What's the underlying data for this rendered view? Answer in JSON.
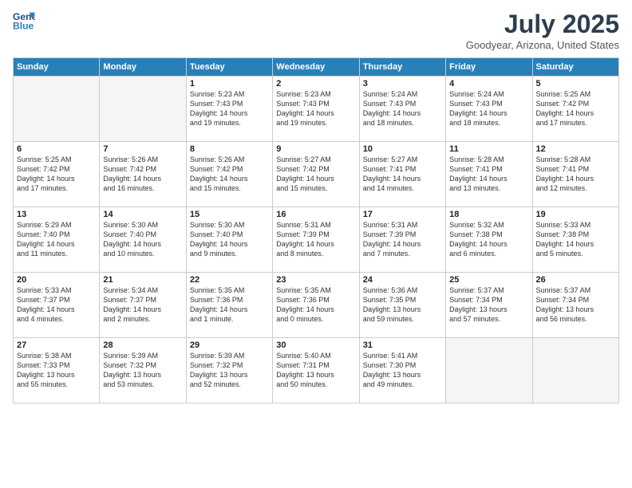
{
  "header": {
    "logo_line1": "General",
    "logo_line2": "Blue",
    "month": "July 2025",
    "location": "Goodyear, Arizona, United States"
  },
  "days_of_week": [
    "Sunday",
    "Monday",
    "Tuesday",
    "Wednesday",
    "Thursday",
    "Friday",
    "Saturday"
  ],
  "weeks": [
    [
      {
        "day": "",
        "text": ""
      },
      {
        "day": "",
        "text": ""
      },
      {
        "day": "1",
        "text": "Sunrise: 5:23 AM\nSunset: 7:43 PM\nDaylight: 14 hours\nand 19 minutes."
      },
      {
        "day": "2",
        "text": "Sunrise: 5:23 AM\nSunset: 7:43 PM\nDaylight: 14 hours\nand 19 minutes."
      },
      {
        "day": "3",
        "text": "Sunrise: 5:24 AM\nSunset: 7:43 PM\nDaylight: 14 hours\nand 18 minutes."
      },
      {
        "day": "4",
        "text": "Sunrise: 5:24 AM\nSunset: 7:43 PM\nDaylight: 14 hours\nand 18 minutes."
      },
      {
        "day": "5",
        "text": "Sunrise: 5:25 AM\nSunset: 7:42 PM\nDaylight: 14 hours\nand 17 minutes."
      }
    ],
    [
      {
        "day": "6",
        "text": "Sunrise: 5:25 AM\nSunset: 7:42 PM\nDaylight: 14 hours\nand 17 minutes."
      },
      {
        "day": "7",
        "text": "Sunrise: 5:26 AM\nSunset: 7:42 PM\nDaylight: 14 hours\nand 16 minutes."
      },
      {
        "day": "8",
        "text": "Sunrise: 5:26 AM\nSunset: 7:42 PM\nDaylight: 14 hours\nand 15 minutes."
      },
      {
        "day": "9",
        "text": "Sunrise: 5:27 AM\nSunset: 7:42 PM\nDaylight: 14 hours\nand 15 minutes."
      },
      {
        "day": "10",
        "text": "Sunrise: 5:27 AM\nSunset: 7:41 PM\nDaylight: 14 hours\nand 14 minutes."
      },
      {
        "day": "11",
        "text": "Sunrise: 5:28 AM\nSunset: 7:41 PM\nDaylight: 14 hours\nand 13 minutes."
      },
      {
        "day": "12",
        "text": "Sunrise: 5:28 AM\nSunset: 7:41 PM\nDaylight: 14 hours\nand 12 minutes."
      }
    ],
    [
      {
        "day": "13",
        "text": "Sunrise: 5:29 AM\nSunset: 7:40 PM\nDaylight: 14 hours\nand 11 minutes."
      },
      {
        "day": "14",
        "text": "Sunrise: 5:30 AM\nSunset: 7:40 PM\nDaylight: 14 hours\nand 10 minutes."
      },
      {
        "day": "15",
        "text": "Sunrise: 5:30 AM\nSunset: 7:40 PM\nDaylight: 14 hours\nand 9 minutes."
      },
      {
        "day": "16",
        "text": "Sunrise: 5:31 AM\nSunset: 7:39 PM\nDaylight: 14 hours\nand 8 minutes."
      },
      {
        "day": "17",
        "text": "Sunrise: 5:31 AM\nSunset: 7:39 PM\nDaylight: 14 hours\nand 7 minutes."
      },
      {
        "day": "18",
        "text": "Sunrise: 5:32 AM\nSunset: 7:38 PM\nDaylight: 14 hours\nand 6 minutes."
      },
      {
        "day": "19",
        "text": "Sunrise: 5:33 AM\nSunset: 7:38 PM\nDaylight: 14 hours\nand 5 minutes."
      }
    ],
    [
      {
        "day": "20",
        "text": "Sunrise: 5:33 AM\nSunset: 7:37 PM\nDaylight: 14 hours\nand 4 minutes."
      },
      {
        "day": "21",
        "text": "Sunrise: 5:34 AM\nSunset: 7:37 PM\nDaylight: 14 hours\nand 2 minutes."
      },
      {
        "day": "22",
        "text": "Sunrise: 5:35 AM\nSunset: 7:36 PM\nDaylight: 14 hours\nand 1 minute."
      },
      {
        "day": "23",
        "text": "Sunrise: 5:35 AM\nSunset: 7:36 PM\nDaylight: 14 hours\nand 0 minutes."
      },
      {
        "day": "24",
        "text": "Sunrise: 5:36 AM\nSunset: 7:35 PM\nDaylight: 13 hours\nand 59 minutes."
      },
      {
        "day": "25",
        "text": "Sunrise: 5:37 AM\nSunset: 7:34 PM\nDaylight: 13 hours\nand 57 minutes."
      },
      {
        "day": "26",
        "text": "Sunrise: 5:37 AM\nSunset: 7:34 PM\nDaylight: 13 hours\nand 56 minutes."
      }
    ],
    [
      {
        "day": "27",
        "text": "Sunrise: 5:38 AM\nSunset: 7:33 PM\nDaylight: 13 hours\nand 55 minutes."
      },
      {
        "day": "28",
        "text": "Sunrise: 5:39 AM\nSunset: 7:32 PM\nDaylight: 13 hours\nand 53 minutes."
      },
      {
        "day": "29",
        "text": "Sunrise: 5:39 AM\nSunset: 7:32 PM\nDaylight: 13 hours\nand 52 minutes."
      },
      {
        "day": "30",
        "text": "Sunrise: 5:40 AM\nSunset: 7:31 PM\nDaylight: 13 hours\nand 50 minutes."
      },
      {
        "day": "31",
        "text": "Sunrise: 5:41 AM\nSunset: 7:30 PM\nDaylight: 13 hours\nand 49 minutes."
      },
      {
        "day": "",
        "text": ""
      },
      {
        "day": "",
        "text": ""
      }
    ]
  ]
}
